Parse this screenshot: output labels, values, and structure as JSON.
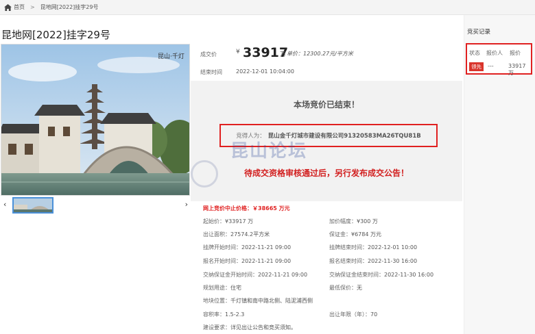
{
  "breadcrumb": {
    "home": "首页",
    "separator": ">",
    "current": "昆地网[2022]挂字29号"
  },
  "title": "昆地网[2022]挂字29号",
  "gallery": {
    "caption": "昆山·千灯",
    "prev_icon": "‹",
    "next_icon": "›"
  },
  "deal": {
    "price_label": "成交价",
    "currency": "¥",
    "price": "33917",
    "price_unit": "万",
    "unit_price": "单价：12300.27元/平方米",
    "end_label": "结束时间",
    "end_time": "2022-12-01 10:04:00"
  },
  "result": {
    "ended": "本场竞价已结束！",
    "winner_label": "竞得人为：",
    "winner": "昆山金千灯城市建设有限公司91320583MA26TQU81B",
    "pending": "待成交资格审核通过后，另行发布成交公告！",
    "watermark": "昆山论坛"
  },
  "cap_price": "网上竞价中止价格：￥38665 万元",
  "details": {
    "start_price_k": "起始价：",
    "start_price_v": "¥33917 万",
    "increment_k": "加价幅度：",
    "increment_v": "¥300 万",
    "area_k": "出让面积：",
    "area_v": "27574.2平方米",
    "deposit_k": "保证金：",
    "deposit_v": "¥6784 万元",
    "list_start_k": "挂牌开始时间：",
    "list_start_v": "2022-11-21 09:00",
    "list_end_k": "挂牌结束时间：",
    "list_end_v": "2022-12-01 10:00",
    "reg_start_k": "报名开始时间：",
    "reg_start_v": "2022-11-21 09:00",
    "reg_end_k": "报名结束时间：",
    "reg_end_v": "2022-11-30 16:00",
    "dep_start_k": "交纳保证金开始时间：",
    "dep_start_v": "2022-11-21 09:00",
    "dep_end_k": "交纳保证金结束时间：",
    "dep_end_v": "2022-11-30 16:00",
    "use_k": "规划用途：",
    "use_v": "住宅",
    "lowest_k": "最低保价：",
    "lowest_v": "无",
    "loc_k": "地块位置：",
    "loc_v": "千灯镇和南中路北侧、陆泥浦西侧",
    "far_k": "容积率：",
    "far_v": "1.5-2.3",
    "years_k": "出让年限（年）：",
    "years_v": "70",
    "req_k": "建设要求：",
    "req_v": "详见出让公告和竞买须知。"
  },
  "records": {
    "title": "竞买记录",
    "col_status": "状态",
    "col_bidder": "报价人",
    "col_price": "报价",
    "row_status": "领先",
    "row_bidder": "---",
    "row_price": "33917 万"
  },
  "colors": {
    "accent_red": "#e02020",
    "lead_badge": "#d9342b"
  }
}
